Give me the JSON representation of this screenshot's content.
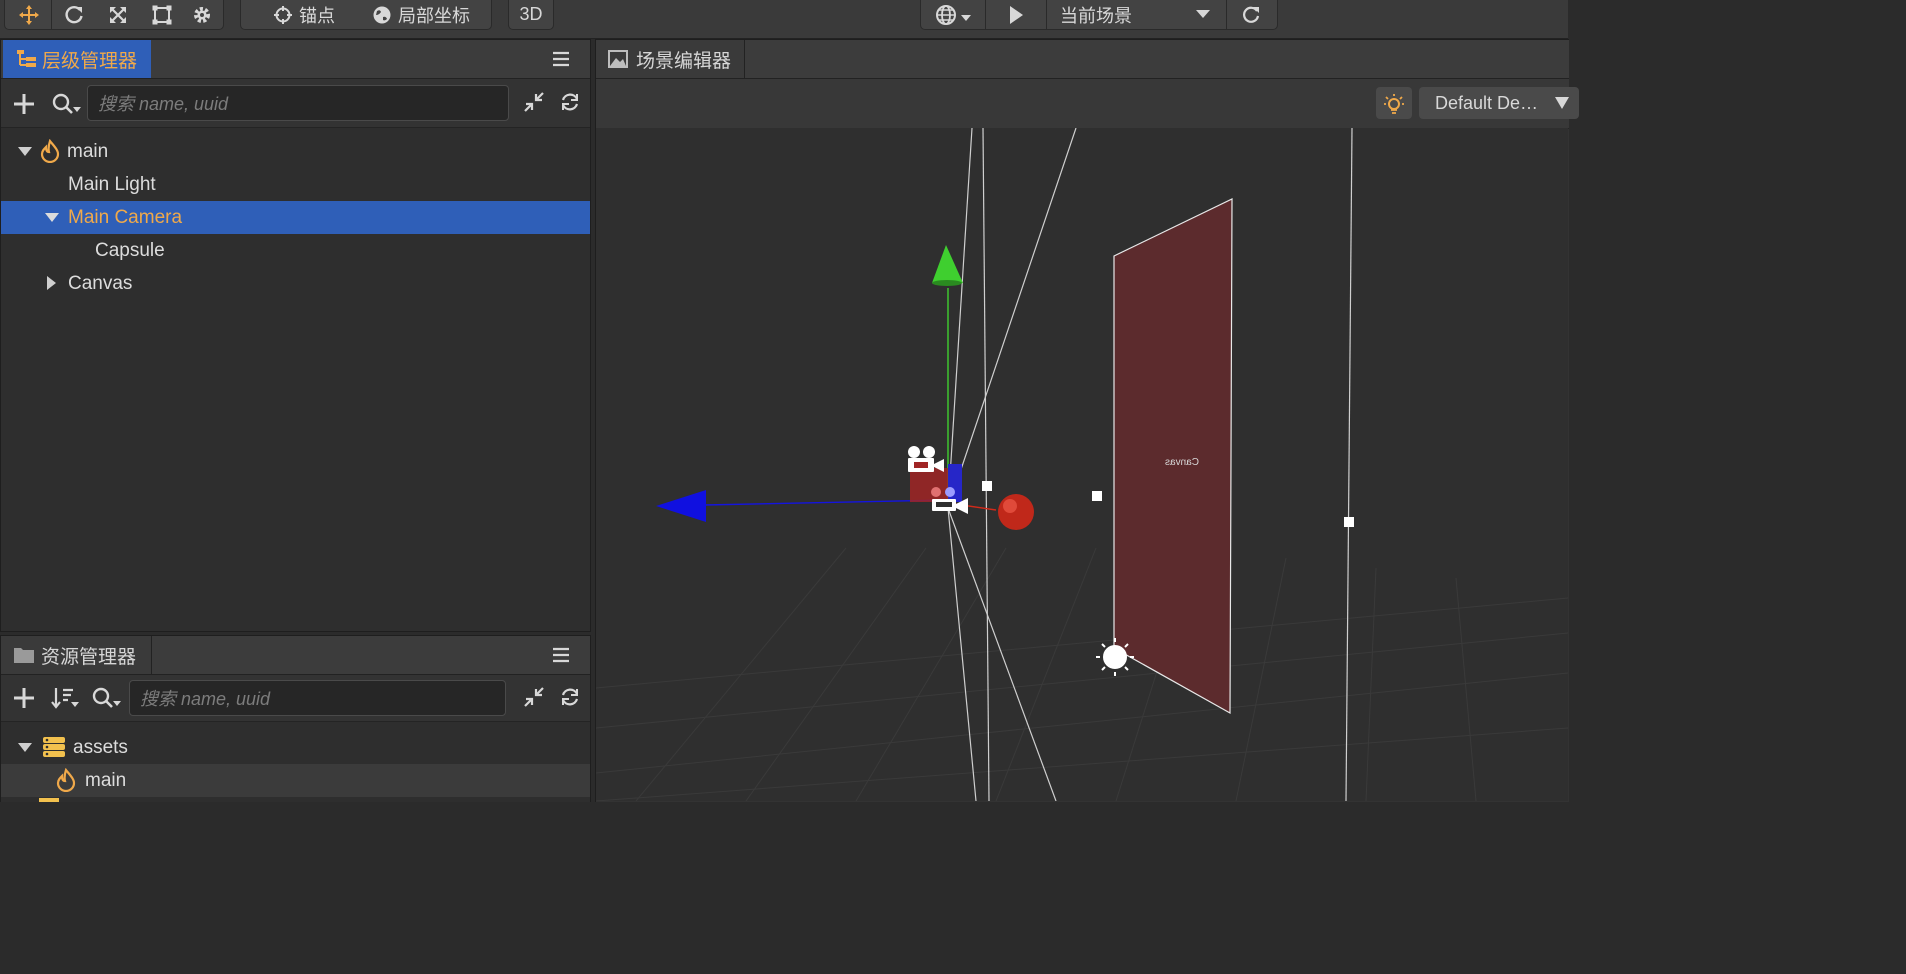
{
  "toolbar": {
    "anchor_label": "锚点",
    "local_coord_label": "局部坐标",
    "mode_3d_label": "3D",
    "scene_select_value": "当前场景"
  },
  "hierarchy": {
    "title": "层级管理器",
    "search_placeholder": "搜索 name, uuid",
    "nodes": [
      {
        "label": "main"
      },
      {
        "label": "Main Light"
      },
      {
        "label": "Main Camera"
      },
      {
        "label": "Capsule"
      },
      {
        "label": "Canvas"
      }
    ]
  },
  "assets": {
    "title": "资源管理器",
    "search_placeholder": "搜索 name, uuid",
    "items": [
      {
        "label": "assets"
      },
      {
        "label": "main"
      }
    ]
  },
  "scene": {
    "title": "场景编辑器",
    "camera_select_value": "Default De…",
    "canvas_mirrored_text": "Canvas"
  },
  "colors": {
    "accent_orange": "#f0a94a",
    "selection_blue": "#2f5fb8",
    "axis_x": "#d12a1a",
    "axis_y": "#3fcf2f",
    "axis_z": "#1010e0",
    "canvas_plane": "#5c2b2d"
  }
}
